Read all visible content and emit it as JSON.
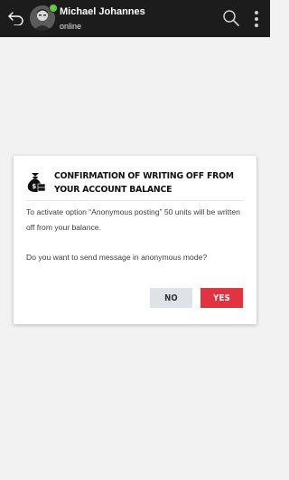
{
  "header": {
    "contact_name": "Michael Johannes",
    "status": "online",
    "icons": {
      "back": "back-arrow-icon",
      "search": "search-icon",
      "more": "more-vertical-icon"
    },
    "online_indicator_color": "#5cd13b"
  },
  "dialog": {
    "icon": "money-bag-icon",
    "title": "Confirmation of writing off from your account balance",
    "message": "To activate option “Anonymous posting” 50 units will be written off from your balance.",
    "question": "Do you want to send message in anonymous mode?",
    "no_label": "NO",
    "yes_label": "YES",
    "colors": {
      "yes_button": "#e23341",
      "no_button": "#dfe3e7"
    }
  }
}
